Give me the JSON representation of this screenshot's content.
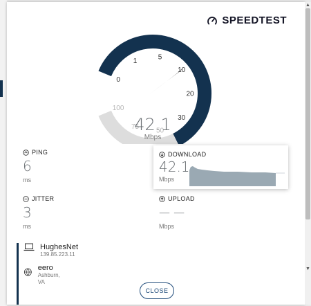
{
  "logo": {
    "text": "SPEEDTEST"
  },
  "gauge": {
    "ticks": [
      "0",
      "1",
      "5",
      "10",
      "20",
      "30",
      "50",
      "75",
      "100"
    ],
    "value": "42.1",
    "unit": "Mbps",
    "needle_value": 42.1,
    "colors": {
      "active": "#13324f",
      "inactive": "#dddddd"
    }
  },
  "ping": {
    "label": "PING",
    "value": "6",
    "unit": "ms"
  },
  "download": {
    "label": "DOWNLOAD",
    "value": "42.1",
    "unit": "Mbps"
  },
  "jitter": {
    "label": "JITTER",
    "value": "3",
    "unit": "ms"
  },
  "upload": {
    "label": "UPLOAD",
    "value": "— —",
    "unit": "Mbps"
  },
  "server": {
    "isp_name": "HughesNet",
    "isp_ip": "139.85.223.11",
    "host_name": "eero",
    "host_location": "Ashburn, VA"
  },
  "close_label": "CLOSE"
}
